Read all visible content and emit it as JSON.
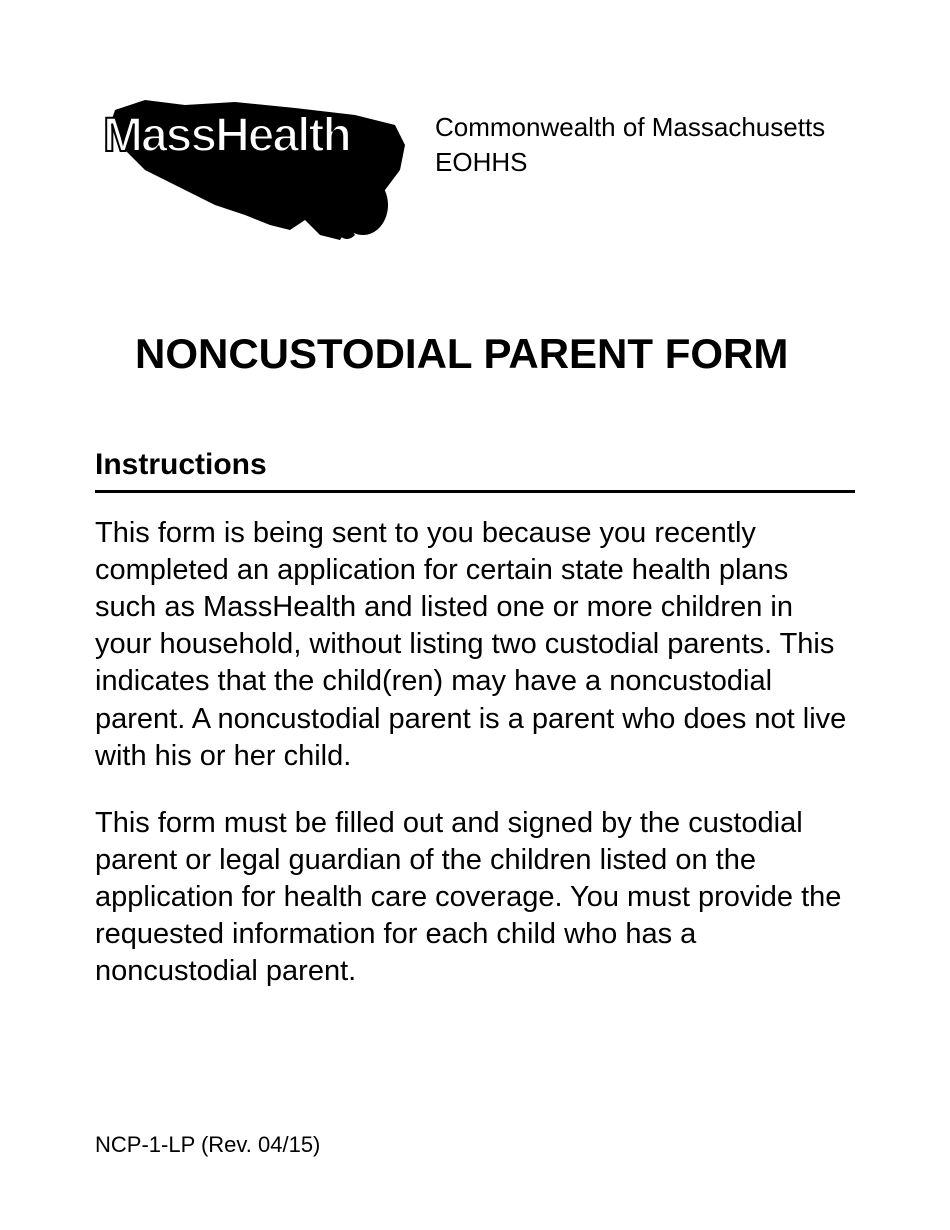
{
  "header": {
    "logo_text": "MassHealth",
    "line1": "Commonwealth of Massachusetts",
    "line2": "EOHHS"
  },
  "title": "NONCUSTODIAL PARENT FORM",
  "section": {
    "heading": "Instructions",
    "paragraph1": "This form is being sent to you because you recently completed an application for certain state health plans such as MassHealth and listed one or more children in your household, without listing two custodial parents. This indicates that the child(ren) may have a noncustodial parent. A noncustodial parent is a parent who does not live with his or her child.",
    "paragraph2": "This form must be filled out and signed by the custodial parent or legal guardian of the children listed on the application for health care coverage. You must provide the requested information for each child who has a noncustodial parent."
  },
  "footer": {
    "form_code": "NCP-1-LP (Rev. 04/15)"
  }
}
